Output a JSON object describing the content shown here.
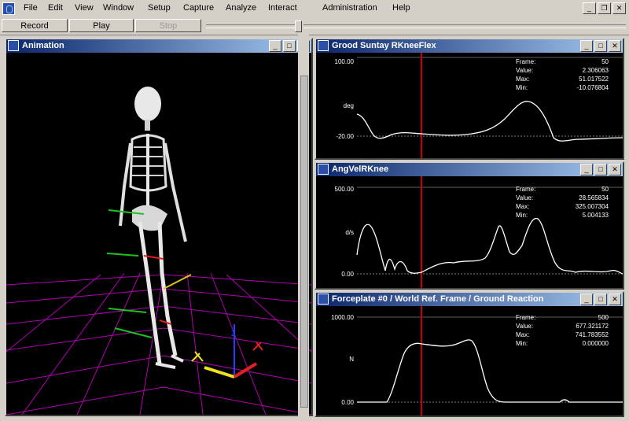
{
  "menubar": {
    "items": [
      "File",
      "Edit",
      "View",
      "Window",
      "Setup",
      "Capture",
      "Analyze",
      "Interact",
      "Administration",
      "Help"
    ]
  },
  "toolbar": {
    "record_label": "Record",
    "play_label": "Play",
    "stop_label": "Stop"
  },
  "animation_window": {
    "title": "Animation"
  },
  "graphs": [
    {
      "title": "Grood Suntay RKneeFlex",
      "ymax_label": "100.00",
      "ymin_label": "-20.00",
      "unit_label": "deg",
      "info": {
        "frame_label": "Frame:",
        "frame": "50",
        "value_label": "Value:",
        "value": "2.306063",
        "max_label": "Max:",
        "max": "51.017522",
        "min_label": "Min:",
        "min": "-10.076804"
      }
    },
    {
      "title": "AngVelRKnee",
      "ymax_label": "500.00",
      "ymin_label": "0.00",
      "unit_label": "d/s",
      "info": {
        "frame_label": "Frame:",
        "frame": "50",
        "value_label": "Value:",
        "value": "28.565834",
        "max_label": "Max:",
        "max": "325.007304",
        "min_label": "Min:",
        "min": "5.004133"
      }
    },
    {
      "title": "Forceplate #0 / World Ref. Frame / Ground Reaction",
      "ymax_label": "1000.00",
      "ymin_label": "0.00",
      "unit_label": "N",
      "info": {
        "frame_label": "Frame:",
        "frame": "500",
        "value_label": "Value:",
        "value": "677.321172",
        "max_label": "Max:",
        "max": "741.783552",
        "min_label": "Min:",
        "min": "0.000000"
      }
    }
  ],
  "colors": {
    "cursor": "#cc0000",
    "curve": "#ffffff",
    "grid": "#b000b0",
    "title_start": "#0a246a",
    "title_end": "#a6caf0"
  },
  "icons": {
    "app": "app-icon",
    "minimize": "minimize-icon",
    "restore": "restore-icon",
    "close": "close-icon"
  }
}
